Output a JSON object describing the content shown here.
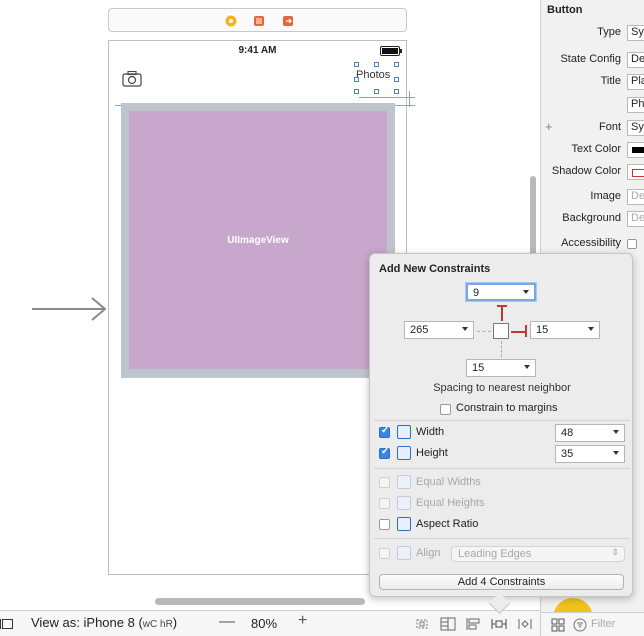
{
  "canvas": {
    "status_time": "9:41 AM",
    "photos_button": "Photos",
    "image_view_label": "UIImageView"
  },
  "bottom_bar": {
    "view_as_prefix": "View as: iPhone 8 (",
    "traits": "wC hR",
    "view_as_suffix": ")",
    "zoom_out": "—",
    "zoom_level": "80%",
    "zoom_in": "+"
  },
  "inspector": {
    "section_title": "Button",
    "rows": [
      {
        "label": "Type",
        "value": "System"
      },
      {
        "label": "State Config",
        "value": "Default"
      },
      {
        "label": "Title",
        "value": "Plain"
      },
      {
        "label": "",
        "value": "Photos"
      },
      {
        "label": "Font",
        "value": "System"
      },
      {
        "label": "Text Color",
        "value": ""
      },
      {
        "label": "Shadow Color",
        "value": ""
      },
      {
        "label": "Image",
        "value": "Default"
      },
      {
        "label": "Background",
        "value": "Default"
      },
      {
        "label": "Accessibility",
        "value": ""
      }
    ],
    "filter_placeholder": "Filter"
  },
  "constraints_popover": {
    "title": "Add New Constraints",
    "top_value": "9",
    "leading_value": "265",
    "trailing_value": "15",
    "bottom_value": "15",
    "spacing_caption": "Spacing to nearest neighbor",
    "constrain_to_margins": {
      "label": "Constrain to margins",
      "checked": false
    },
    "width": {
      "label": "Width",
      "checked": true,
      "value": "48"
    },
    "height": {
      "label": "Height",
      "checked": true,
      "value": "35"
    },
    "equal_widths": {
      "label": "Equal Widths",
      "checked": false,
      "enabled": false
    },
    "equal_heights": {
      "label": "Equal Heights",
      "checked": false,
      "enabled": false
    },
    "aspect_ratio": {
      "label": "Aspect Ratio",
      "checked": false,
      "enabled": true
    },
    "align": {
      "label": "Align",
      "option": "Leading Edges",
      "enabled": false
    },
    "add_button": "Add 4 Constraints"
  },
  "colors": {
    "image_view": "#c7a7cb",
    "strut_active": "#c0392b",
    "accent": "#3b86e2"
  }
}
